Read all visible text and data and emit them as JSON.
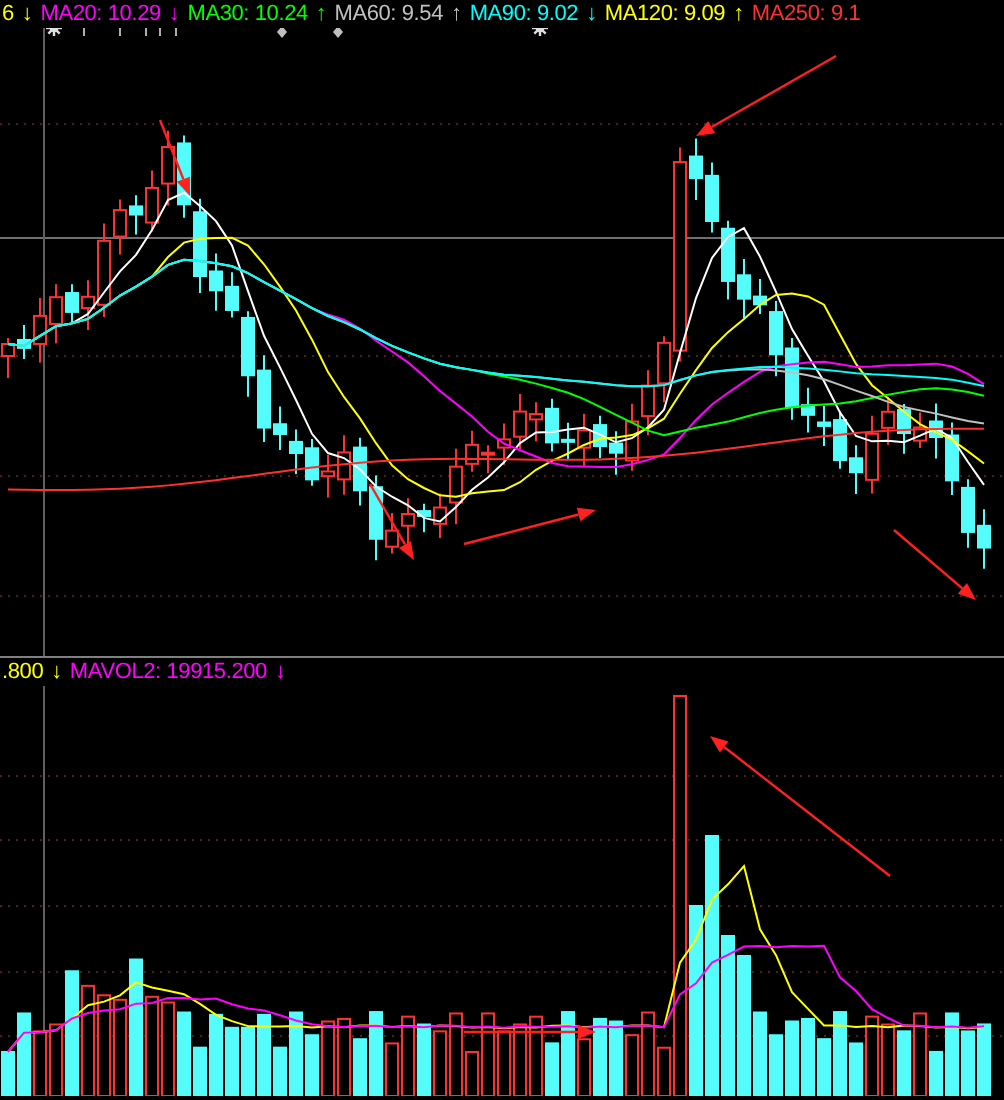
{
  "price_legend": [
    {
      "label": "6",
      "arrow": "↓",
      "color": "#ffff00"
    },
    {
      "label": "MA20: 10.29",
      "arrow": "↓",
      "color": "#ff00ff"
    },
    {
      "label": "MA30: 10.24",
      "arrow": "↑",
      "color": "#00ff00"
    },
    {
      "label": "MA60: 9.54",
      "arrow": "↑",
      "color": "#c0c0c0"
    },
    {
      "label": "MA90: 9.02",
      "arrow": "↓",
      "color": "#00ffff"
    },
    {
      "label": "MA120: 9.09",
      "arrow": "↑",
      "color": "#ffff00"
    },
    {
      "label": "MA250: 9.1",
      "color": "#ff3030"
    }
  ],
  "volume_legend": [
    {
      "label": ".800",
      "arrow": "↓",
      "color": "#ffff00"
    },
    {
      "label": "MAVOL2: 19915.200",
      "arrow": "↓",
      "color": "#ff00ff"
    }
  ]
}
